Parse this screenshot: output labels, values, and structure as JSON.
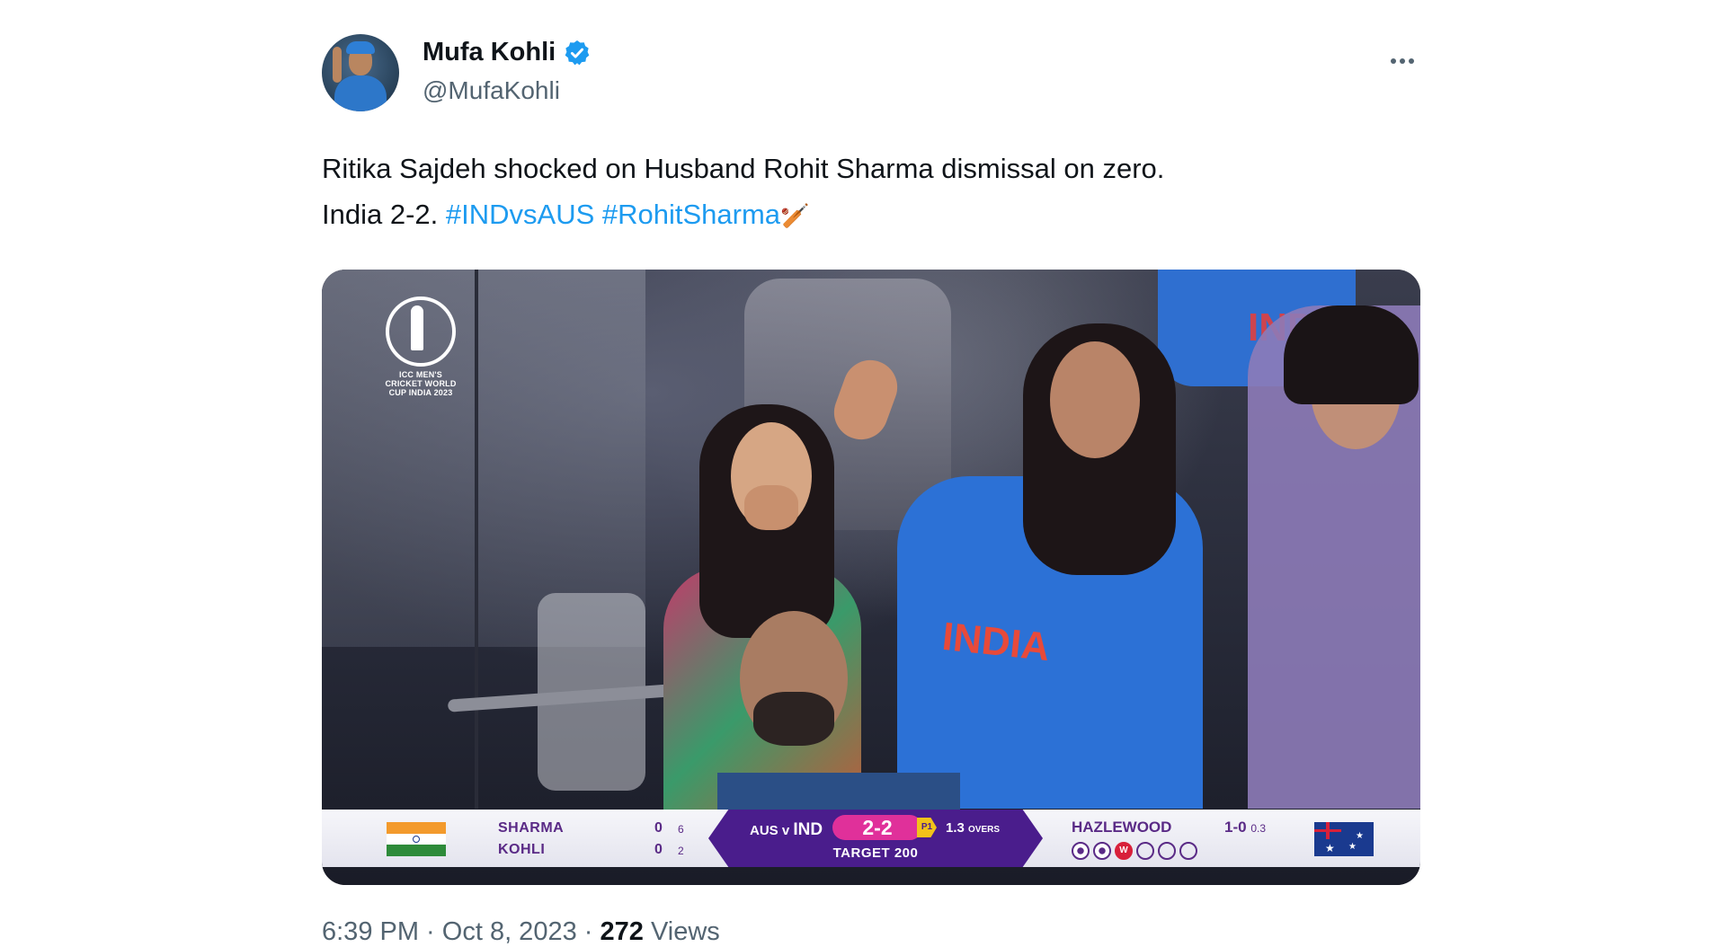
{
  "tweet": {
    "author_name": "Mufa Kohli",
    "author_handle": "@MufaKohli",
    "text_line1": "Ritika Sajdeh shocked on Husband Rohit Sharma dismissal on zero.",
    "text_line2_prefix": "India 2-2.",
    "hashtags": [
      "#INDvsAUS",
      "#RohitSharma"
    ],
    "emoji_icon": "cricket-icon",
    "timestamp": "6:39 PM · Oct 8, 2023 ·",
    "views_count": "272",
    "views_label": "Views"
  },
  "media": {
    "logo_text": "ICC MEN'S CRICKET WORLD CUP INDIA 2023",
    "jersey_text": "INDIA",
    "scorebar": {
      "batter1_name": "SHARMA",
      "batter1_runs": "0",
      "batter1_balls": "6",
      "batter2_name": "KOHLI",
      "batter2_runs": "0",
      "batter2_balls": "2",
      "teams_prefix": "AUS v",
      "teams_batting": "IND",
      "score": "2-2",
      "powerplay": "P1",
      "overs": "1.3",
      "overs_label": "OVERS",
      "target": "TARGET 200",
      "bowler_name": "HAZLEWOOD",
      "bowler_figures": "1-0",
      "bowler_overs": "0.3",
      "ball_by_ball": [
        "•",
        "•",
        "W",
        "",
        "",
        ""
      ]
    },
    "colors": {
      "scoreboard_purple": "#4a1d8c",
      "score_pink": "#e0309a",
      "powerplay_yellow": "#f2c21a",
      "wicket_red": "#d8203a"
    }
  },
  "colors": {
    "link": "#1d9bf0",
    "verified": "#1d9bf0",
    "secondary_text": "#536471",
    "primary_text": "#0f1419"
  }
}
